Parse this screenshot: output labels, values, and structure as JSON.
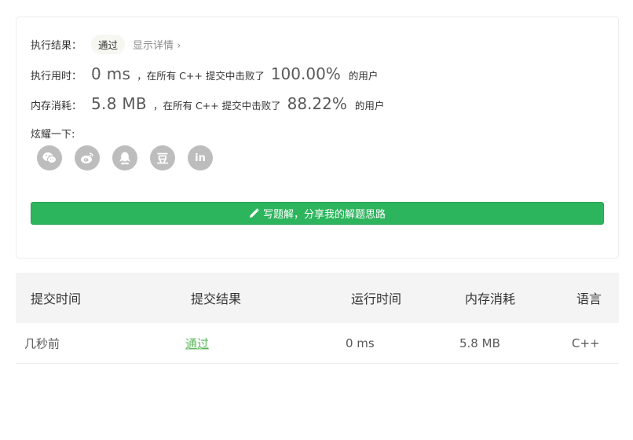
{
  "result": {
    "label": "执行结果：",
    "status": "通过",
    "detail_link": "显示详情",
    "chevron": "›"
  },
  "runtime": {
    "label": "执行用时：",
    "value": "0 ms",
    "middle": "，在所有 C++ 提交中击败了",
    "percent": "100.00%",
    "suffix": "的用户"
  },
  "memory": {
    "label": "内存消耗：",
    "value": "5.8 MB",
    "middle": "，在所有 C++ 提交中击败了",
    "percent": "88.22%",
    "suffix": "的用户"
  },
  "share": {
    "label": "炫耀一下:",
    "icons": [
      "wechat-icon",
      "weibo-icon",
      "qq-icon",
      "douban-icon",
      "linkedin-icon"
    ],
    "douban_glyph": "豆",
    "linkedin_glyph": "in",
    "button_label": "写题解，分享我的解题思路"
  },
  "table": {
    "headers": [
      "提交时间",
      "提交结果",
      "运行时间",
      "内存消耗",
      "语言"
    ],
    "rows": [
      {
        "time": "几秒前",
        "result": "通过",
        "runtime": "0 ms",
        "memory": "5.8 MB",
        "lang": "C++"
      }
    ]
  },
  "colors": {
    "accent_green": "#2db55d",
    "pass_link": "#5cb85c",
    "icon_gray": "#bdbdbd"
  }
}
